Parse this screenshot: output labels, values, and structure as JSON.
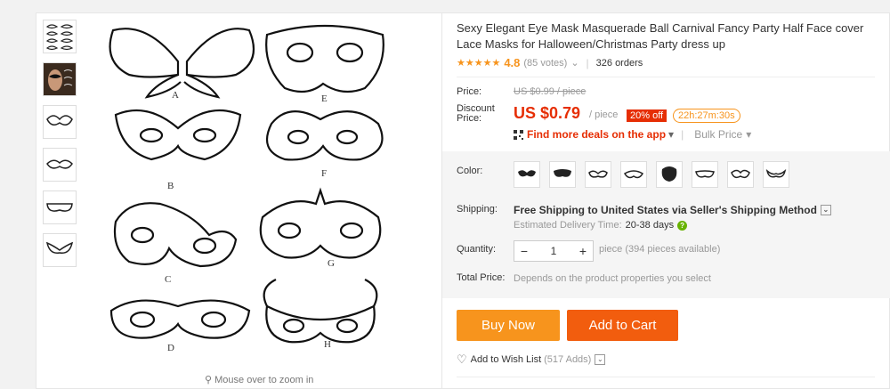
{
  "gallery": {
    "zoom_hint": "Mouse over to zoom in",
    "mask_labels": [
      "A",
      "B",
      "C",
      "D",
      "E",
      "F",
      "G",
      "H"
    ]
  },
  "product": {
    "title": "Sexy Elegant Eye Mask Masquerade Ball Carnival Fancy Party Half Face cover Lace Masks for Halloween/Christmas Party dress up",
    "stars": "★★★★★",
    "rating": "4.8",
    "votes": "(85 votes)",
    "votes_chevron": "⌄",
    "orders": "326 orders"
  },
  "pricing": {
    "price_label": "Price:",
    "old_price": "US $0.99 / piece",
    "discount_label": "Discount Price:",
    "price": "US $0.79",
    "unit": "/ piece",
    "discount_badge": "20% off",
    "countdown": "22h:27m:30s",
    "deals_link": "Find more deals on the app",
    "deals_chevron": "▾",
    "bulk_price": "Bulk Price",
    "bulk_chevron": "▾"
  },
  "options": {
    "color_label": "Color:",
    "swatch_count": 8,
    "shipping_label": "Shipping:",
    "shipping_main": "Free Shipping to United States via Seller's Shipping Method",
    "shipping_chevron": "⌄",
    "delivery_label": "Estimated Delivery Time:",
    "delivery_days": "20-38 days",
    "help_icon": "?",
    "quantity_label": "Quantity:",
    "qty_minus": "−",
    "quantity": "1",
    "qty_plus": "+",
    "availability": "piece (394 pieces available)",
    "total_label": "Total Price:",
    "total_note": "Depends on the product properties you select"
  },
  "actions": {
    "buy_now": "Buy Now",
    "add_to_cart": "Add to Cart",
    "heart_icon": "♡",
    "wishlist": "Add to Wish List",
    "wishlist_count": "(517 Adds)",
    "wishlist_chevron": "⌄"
  },
  "colors": {
    "accent": "#f7941d",
    "cart": "#f25d0e",
    "price": "#e62e04"
  }
}
